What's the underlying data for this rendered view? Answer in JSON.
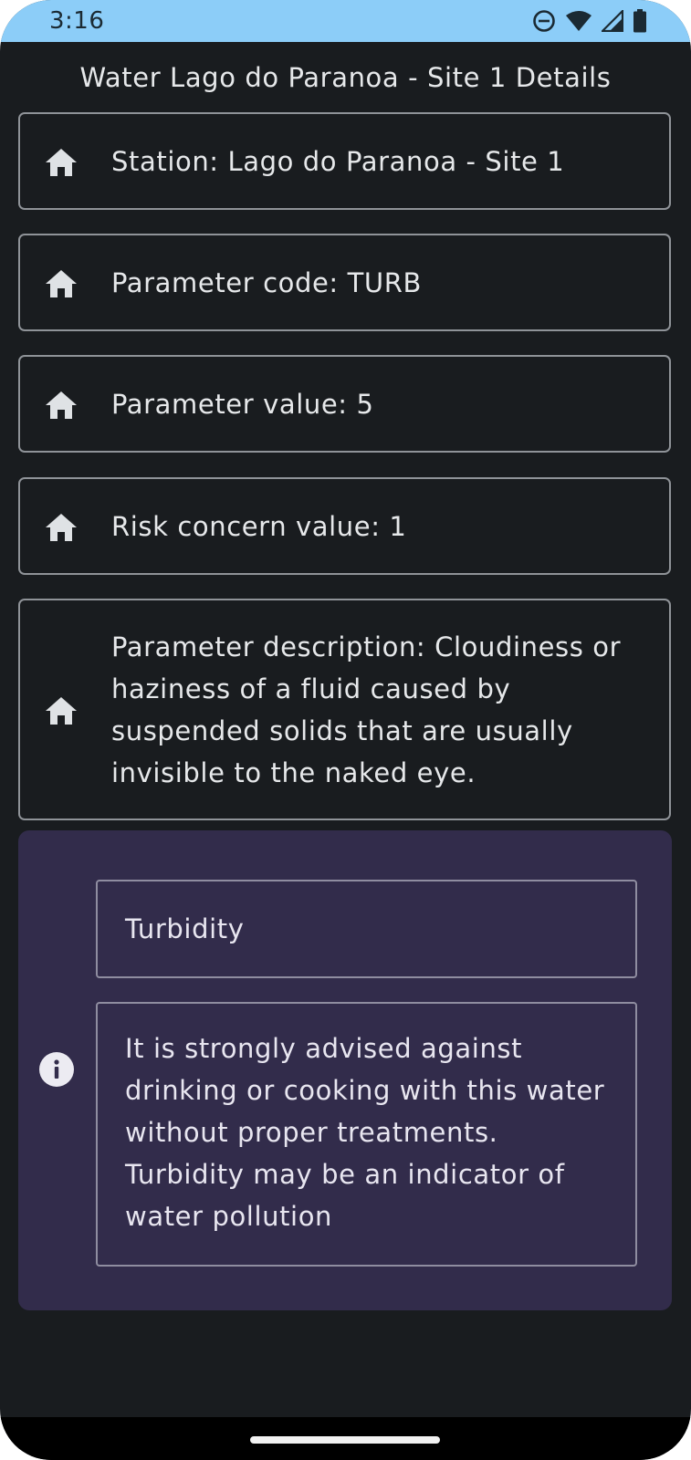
{
  "status_bar": {
    "time": "3:16",
    "background_color": "#8ccdf8",
    "icons": [
      "do-not-disturb-icon",
      "wifi-icon",
      "cellular-signal-icon",
      "battery-icon"
    ]
  },
  "header": {
    "title": "Water Lago do Paranoa - Site 1 Details"
  },
  "details": [
    {
      "icon": "home-icon",
      "text": "Station: Lago do Paranoa - Site 1"
    },
    {
      "icon": "home-icon",
      "text": "Parameter code: TURB"
    },
    {
      "icon": "home-icon",
      "text": "Parameter value: 5"
    },
    {
      "icon": "home-icon",
      "text": "Risk concern value: 1"
    },
    {
      "icon": "home-icon",
      "text": "Parameter description: Cloudiness or haziness of a fluid caused by suspended solids that are usually invisible to the naked eye."
    }
  ],
  "advisory": {
    "icon": "info-icon",
    "title": "Turbidity",
    "message": "It is strongly advised against drinking or cooking with this water without proper treatments. Turbidity may be an indicator of water pollution",
    "background_color": "#322c4b"
  },
  "colors": {
    "background": "#191c1f",
    "text": "#e6e8ea",
    "border": "#8f9398"
  }
}
